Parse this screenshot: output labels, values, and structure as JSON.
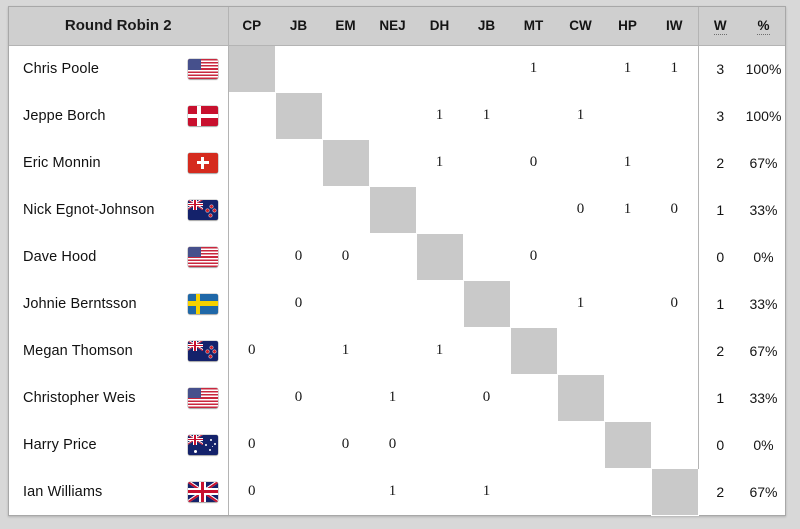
{
  "header": {
    "title": "Round Robin 2",
    "opponent_columns": [
      "CP",
      "JB",
      "EM",
      "NEJ",
      "DH",
      "JB",
      "MT",
      "CW",
      "HP",
      "IW"
    ],
    "wins_label": "W",
    "percent_label": "%"
  },
  "rows": [
    {
      "name": "Chris Poole",
      "flag": "usa",
      "flag_name": "flag-united-states",
      "results": [
        "",
        "",
        "",
        "",
        "",
        "",
        "1",
        "",
        "1",
        "1"
      ],
      "wins": "3",
      "percent": "100%"
    },
    {
      "name": "Jeppe Borch",
      "flag": "dnk",
      "flag_name": "flag-denmark",
      "results": [
        "",
        "",
        "",
        "",
        "1",
        "1",
        "",
        "1",
        "",
        ""
      ],
      "wins": "3",
      "percent": "100%"
    },
    {
      "name": "Eric Monnin",
      "flag": "che",
      "flag_name": "flag-switzerland",
      "results": [
        "",
        "",
        "",
        "",
        "1",
        "",
        "0",
        "",
        "1",
        ""
      ],
      "wins": "2",
      "percent": "67%"
    },
    {
      "name": "Nick Egnot-Johnson",
      "flag": "nzl",
      "flag_name": "flag-new-zealand",
      "results": [
        "",
        "",
        "",
        "",
        "",
        "",
        "",
        "0",
        "1",
        "0"
      ],
      "wins": "1",
      "percent": "33%"
    },
    {
      "name": "Dave Hood",
      "flag": "usa",
      "flag_name": "flag-united-states",
      "results": [
        "",
        "0",
        "0",
        "",
        "",
        "",
        "0",
        "",
        "",
        ""
      ],
      "wins": "0",
      "percent": "0%"
    },
    {
      "name": "Johnie Berntsson",
      "flag": "swe",
      "flag_name": "flag-sweden",
      "results": [
        "",
        "0",
        "",
        "",
        "",
        "",
        "",
        "1",
        "",
        "0"
      ],
      "wins": "1",
      "percent": "33%"
    },
    {
      "name": "Megan Thomson",
      "flag": "nzl",
      "flag_name": "flag-new-zealand",
      "results": [
        "0",
        "",
        "1",
        "",
        "1",
        "",
        "",
        "",
        "",
        ""
      ],
      "wins": "2",
      "percent": "67%"
    },
    {
      "name": "Christopher Weis",
      "flag": "usa",
      "flag_name": "flag-united-states",
      "results": [
        "",
        "0",
        "",
        "1",
        "",
        "0",
        "",
        "",
        "",
        ""
      ],
      "wins": "1",
      "percent": "33%"
    },
    {
      "name": "Harry Price",
      "flag": "aus",
      "flag_name": "flag-australia",
      "results": [
        "0",
        "",
        "0",
        "0",
        "",
        "",
        "",
        "",
        "",
        ""
      ],
      "wins": "0",
      "percent": "0%"
    },
    {
      "name": "Ian Williams",
      "flag": "gbr",
      "flag_name": "flag-united-kingdom",
      "results": [
        "0",
        "",
        "",
        "1",
        "",
        "1",
        "",
        "",
        "",
        ""
      ],
      "wins": "2",
      "percent": "67%"
    }
  ],
  "colors": {
    "header_bg": "#cfcfcf",
    "page_bg": "#d8d8d8",
    "diagonal_cell": "#c9c9c9",
    "grid_line": "#b4b4b4",
    "text": "#141414"
  }
}
